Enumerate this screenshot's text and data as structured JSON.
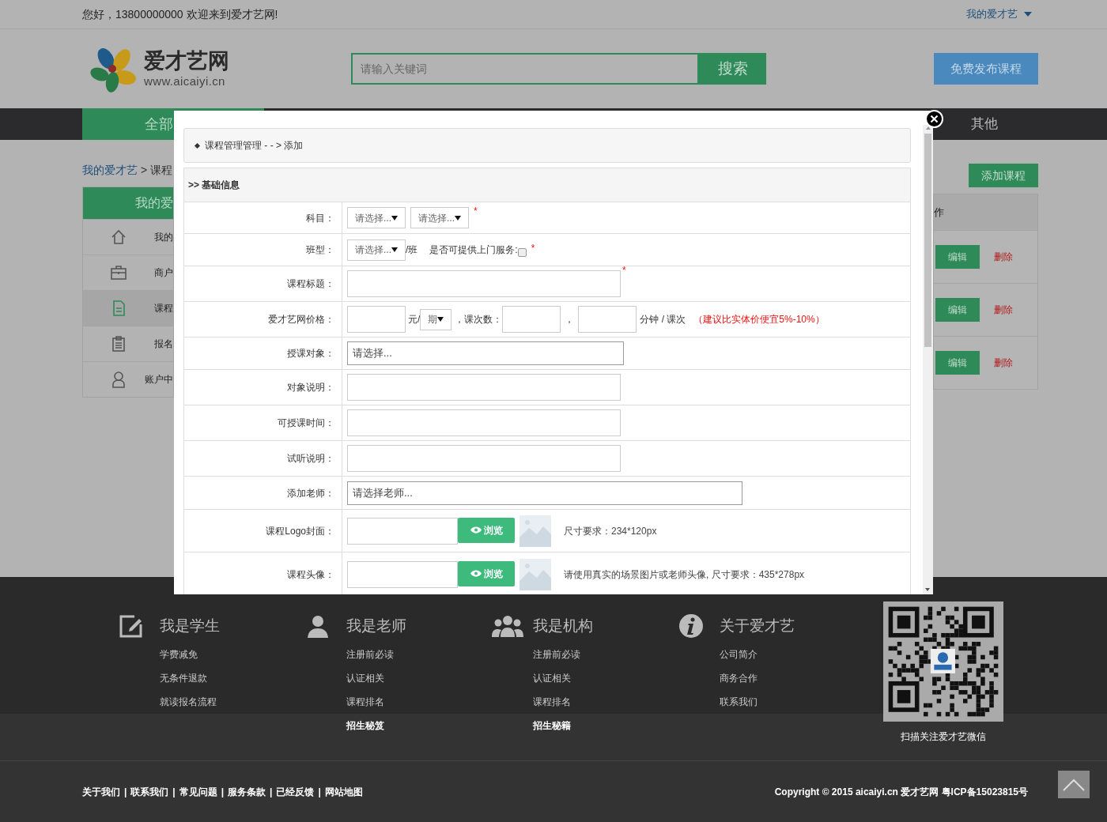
{
  "top_bar": {
    "greeting": "您好，13800000000 欢迎来到爱才艺网!",
    "account_menu": "我的爱才艺"
  },
  "header": {
    "logo_name": "爱才艺网",
    "logo_url": "www.aicaiyi.cn",
    "search": {
      "placeholder": "请输入关键词",
      "button": "搜索"
    },
    "publish_button": "免费发布课程"
  },
  "nav": [
    {
      "label": "全部",
      "selected": true
    },
    {
      "label": "其他",
      "selected": false
    }
  ],
  "breadcrumb": {
    "link": "我的爱才艺",
    "rest": "> 课程"
  },
  "sidebar": {
    "title": "我的爱",
    "items": [
      {
        "label": "我的",
        "selected": false
      },
      {
        "label": "商户",
        "selected": false
      },
      {
        "label": "课程",
        "selected": true
      },
      {
        "label": "报名",
        "selected": false
      },
      {
        "label": "账户中",
        "selected": false
      }
    ]
  },
  "add_button": "添加课程",
  "table": {
    "column_header": "作",
    "rows": [
      {
        "edit": "编辑",
        "delete": "删除"
      },
      {
        "edit": "编辑",
        "delete": "删除"
      },
      {
        "edit": "编辑",
        "delete": "删除"
      }
    ]
  },
  "modal": {
    "breadcrumb": "课程管理管理 - - > 添加",
    "section": ">> 基础信息",
    "rows": [
      {
        "kind": "selects",
        "label": "科目：",
        "selects": [
          "请选择...",
          "请选择..."
        ],
        "mark": "*"
      },
      {
        "kind": "class",
        "label": "班型：",
        "select": "请选择...",
        "unit": "/班",
        "service_label": "是否可提供上门服务:",
        "service_checked": false,
        "mark": "*"
      },
      {
        "kind": "text",
        "label": "课程标题：",
        "mark": "*"
      },
      {
        "kind": "price",
        "label": "爱才艺网价格：",
        "unit": "元/",
        "period": "期",
        "sessions_label": "，课次数：",
        "comma": "，",
        "minutes_label": "分钟 / 课次",
        "hint": "（建议比实体价便宜5%-10%）"
      },
      {
        "kind": "picker",
        "label": "授课对象：",
        "value": "请选择..."
      },
      {
        "kind": "text",
        "label": "对象说明："
      },
      {
        "kind": "text",
        "label": "可授课时间："
      },
      {
        "kind": "text",
        "label": "试听说明："
      },
      {
        "kind": "picker",
        "label": "添加老师：",
        "value": "请选择老师...",
        "wide": true
      },
      {
        "kind": "upload",
        "label": "课程Logo封面：",
        "button": "浏览",
        "note": "尺寸要求：234*120px"
      },
      {
        "kind": "upload",
        "label": "课程头像：",
        "button": "浏览",
        "note": "请使用真实的场景图片或老师头像, 尺寸要求：435*278px"
      }
    ]
  },
  "footer": {
    "columns": [
      {
        "title": "我是学生",
        "links": [
          {
            "label": "学费减免",
            "bold": false
          },
          {
            "label": "无条件退款",
            "bold": false
          },
          {
            "label": "就读报名流程",
            "bold": false
          }
        ]
      },
      {
        "title": "我是老师",
        "links": [
          {
            "label": "注册前必读",
            "bold": false
          },
          {
            "label": "认证相关",
            "bold": false
          },
          {
            "label": "课程排名",
            "bold": false
          },
          {
            "label": "招生秘笈",
            "bold": true
          }
        ]
      },
      {
        "title": "我是机构",
        "links": [
          {
            "label": "注册前必读",
            "bold": false
          },
          {
            "label": "认证相关",
            "bold": false
          },
          {
            "label": "课程排名",
            "bold": false
          },
          {
            "label": "招生秘籍",
            "bold": true
          }
        ]
      },
      {
        "title": "关于爱才艺",
        "links": [
          {
            "label": "公司简介",
            "bold": false
          },
          {
            "label": "商务合作",
            "bold": false
          },
          {
            "label": "联系我们",
            "bold": false
          }
        ]
      }
    ],
    "qr_caption": "扫描关注爱才艺微信",
    "bottom_links": [
      "关于我们",
      "联系我们",
      "常见问题",
      "服务条款",
      "已经反馈",
      "网站地图"
    ],
    "separator": "|",
    "copyright": "Copyright © 2015 aicaiyi.cn 爱才艺网 粤ICP备15023815号"
  }
}
